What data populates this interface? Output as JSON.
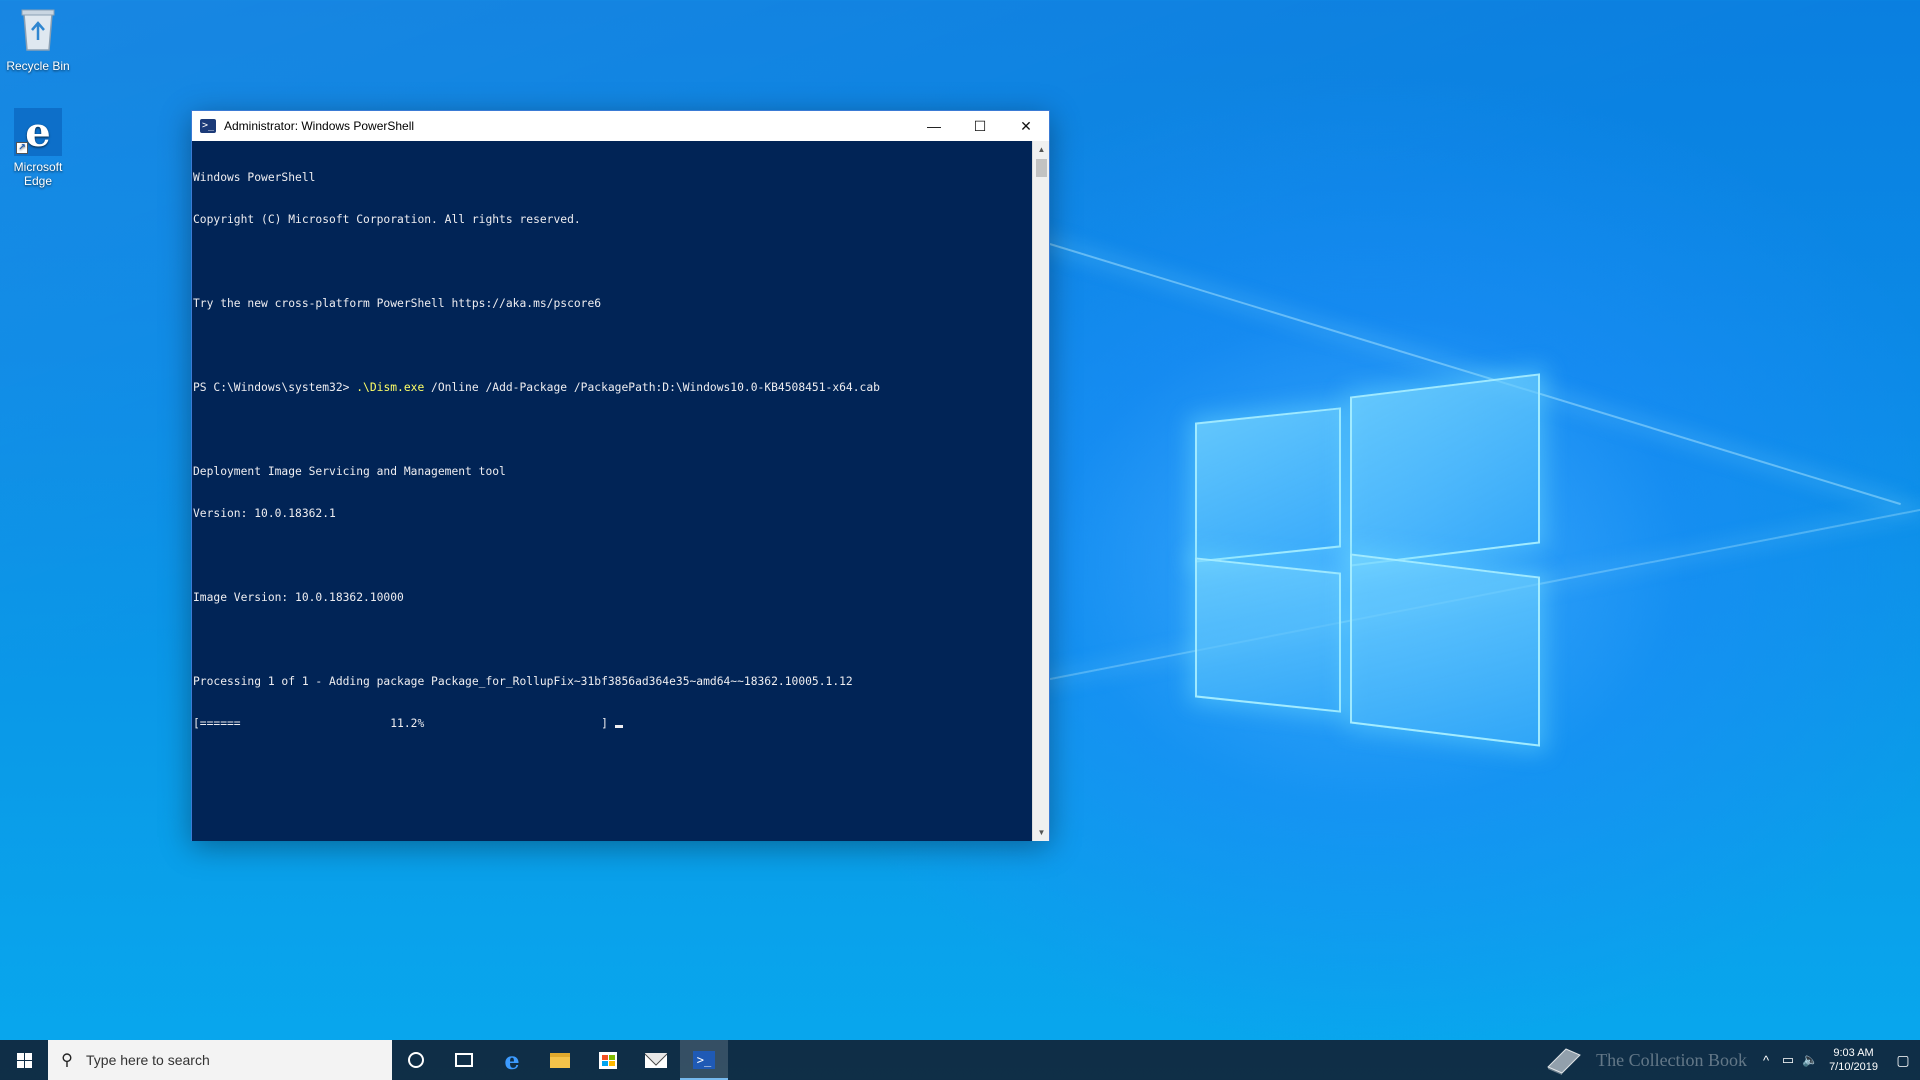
{
  "desktop": {
    "icons": [
      {
        "label": "Recycle Bin"
      },
      {
        "label": "Microsoft\nEdge"
      }
    ]
  },
  "window": {
    "title": "Administrator: Windows PowerShell",
    "controls": {
      "minimize": "—",
      "maximize": "☐",
      "close": "✕"
    }
  },
  "console": {
    "lines": [
      "Windows PowerShell",
      "Copyright (C) Microsoft Corporation. All rights reserved.",
      "",
      "Try the new cross-platform PowerShell https://aka.ms/pscore6",
      "",
      "",
      "",
      "Deployment Image Servicing and Management tool",
      "Version: 10.0.18362.1",
      "",
      "Image Version: 10.0.18362.10000",
      "",
      "Processing 1 of 1 - Adding package Package_for_RollupFix~31bf3856ad364e35~amd64~~18362.10005.1.12"
    ],
    "prompt": {
      "prefix": "PS C:\\Windows\\system32> ",
      "command": ".\\Dism.exe",
      "args": " /Online /Add-Package /PackagePath:D:\\Windows10.0-KB4508451-x64.cab"
    },
    "progress": {
      "text": "[======                      11.2%                          ] ",
      "percent": 11.2
    }
  },
  "taskbar": {
    "search_placeholder": "Type here to search",
    "items": [
      "cortana-icon",
      "task-view-icon",
      "edge-icon",
      "file-explorer-icon",
      "store-icon",
      "mail-icon",
      "powershell-icon"
    ],
    "active_item": "powershell-icon",
    "watermark": "The Collection Book",
    "clock": {
      "time": "9:03 AM",
      "date": "7/10/2019"
    }
  },
  "colors": {
    "console_bg": "#012456",
    "console_fg": "#eeedf0",
    "command_highlight": "#ffff66"
  }
}
